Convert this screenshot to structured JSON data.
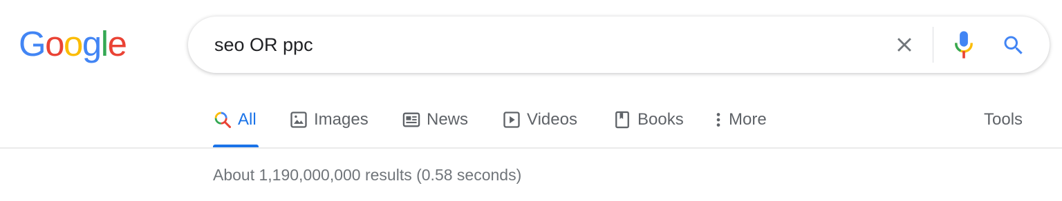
{
  "logo": {
    "letters": [
      "G",
      "o",
      "o",
      "g",
      "l",
      "e"
    ],
    "colors": [
      "#4285F4",
      "#EA4335",
      "#FBBC05",
      "#4285F4",
      "#34A853",
      "#EA4335"
    ]
  },
  "search": {
    "query": "seo OR ppc",
    "clear_icon": "close-icon",
    "voice_icon": "microphone-icon",
    "search_icon": "search-icon"
  },
  "tabs": [
    {
      "label": "All",
      "icon": "search-icon",
      "active": true
    },
    {
      "label": "Images",
      "icon": "image-icon",
      "active": false
    },
    {
      "label": "News",
      "icon": "newspaper-icon",
      "active": false
    },
    {
      "label": "Videos",
      "icon": "play-icon",
      "active": false
    },
    {
      "label": "Books",
      "icon": "book-icon",
      "active": false
    },
    {
      "label": "More",
      "icon": "more-vert-icon",
      "active": false
    }
  ],
  "tools_label": "Tools",
  "result_stats": "About 1,190,000,000 results (0.58 seconds)",
  "colors": {
    "accent": "#1a73e8",
    "tab_text": "#5f6368",
    "stats_text": "#70757a"
  }
}
